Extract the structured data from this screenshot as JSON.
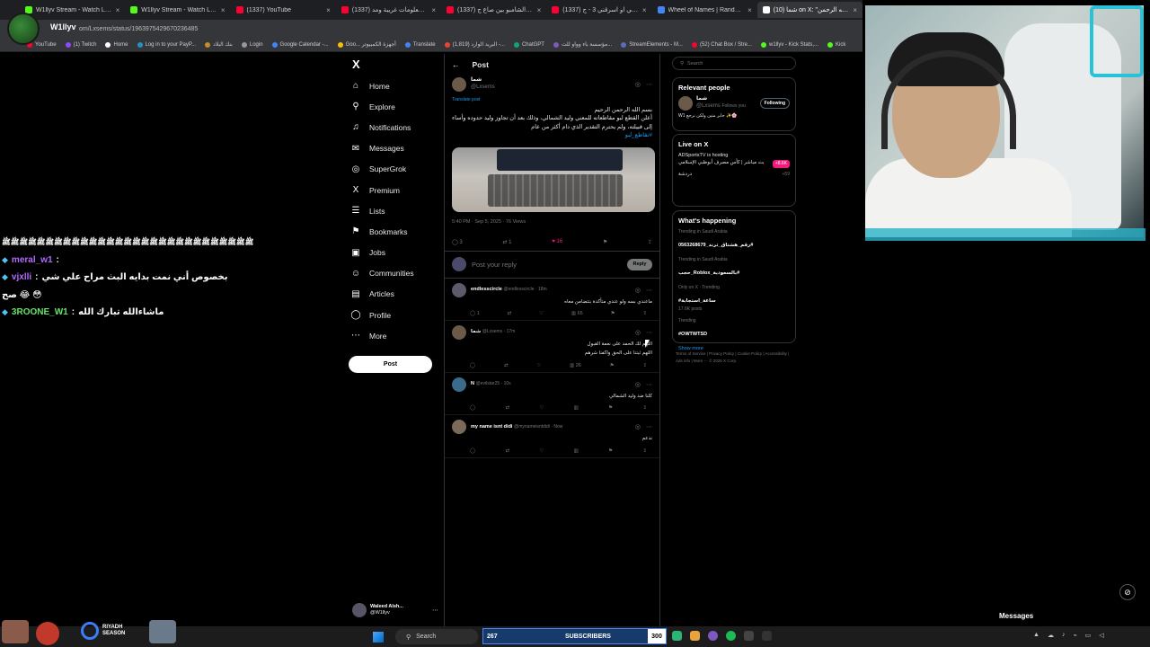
{
  "browser": {
    "tabs": [
      {
        "label": "W1llyv Stream - Watch Live on",
        "color": "#53fc18",
        "active": false
      },
      {
        "label": "W1llyv Stream - Watch Live on",
        "color": "#53fc18",
        "active": false
      },
      {
        "label": "(1337) YouTube",
        "color": "#ff0033",
        "active": false
      },
      {
        "label": "(1337) اربع معلومات غريبة ومد...",
        "color": "#ff0033",
        "active": false
      },
      {
        "label": "(1337) تحدي الشامبو بين صاع ج...",
        "color": "#ff0033",
        "active": false
      },
      {
        "label": "(1337) شاركني او اسرقني 3 - ج...",
        "color": "#ff0033",
        "active": false
      },
      {
        "label": "Wheel of Names | Random nam",
        "color": "#4285f4",
        "active": false
      },
      {
        "label": "(10) شما on X: \"بسم الله الرحمن",
        "color": "#ffffff",
        "active": true
      }
    ],
    "url": "om/Lxsems/status/1963975429670236485",
    "bookmarks": [
      {
        "label": "YouTube",
        "color": "#ff0033"
      },
      {
        "label": "(1) Twitch",
        "color": "#9146ff"
      },
      {
        "label": "Home",
        "color": "#ffffff"
      },
      {
        "label": "Log in to your PayP...",
        "color": "#2790c3"
      },
      {
        "label": "بنك البلاد",
        "color": "#c78b2a"
      },
      {
        "label": "Login",
        "color": "#999999"
      },
      {
        "label": "Google Calendar -...",
        "color": "#4285f4"
      },
      {
        "label": "Goo... أجهزة الكمبيوتر",
        "color": "#fbbc05"
      },
      {
        "label": "Translate",
        "color": "#4285f4"
      },
      {
        "label": "(1,819) البريد الوارد -...",
        "color": "#ea4335"
      },
      {
        "label": "ChatGPT",
        "color": "#10a37f"
      },
      {
        "label": "مؤسسة باء وواو للت...",
        "color": "#7e57c2"
      },
      {
        "label": "StreamElements - M...",
        "color": "#5c6bc0"
      },
      {
        "label": "(52) Chat Box / Stre...",
        "color": "#ff0033"
      },
      {
        "label": "w1llyv - Kick Stats,...",
        "color": "#53fc18"
      },
      {
        "label": "Kick",
        "color": "#53fc18"
      }
    ]
  },
  "streamer": {
    "name": "W1llyv"
  },
  "nav": {
    "logo": "X",
    "items": [
      {
        "label": "Home",
        "icon": "home-icon",
        "glyph": "⌂"
      },
      {
        "label": "Explore",
        "icon": "search-icon",
        "glyph": "⚲"
      },
      {
        "label": "Notifications",
        "icon": "bell-icon",
        "glyph": "♫"
      },
      {
        "label": "Messages",
        "icon": "mail-icon",
        "glyph": "✉"
      },
      {
        "label": "SuperGrok",
        "icon": "grok-icon",
        "glyph": "◎"
      },
      {
        "label": "Premium",
        "icon": "x-premium-icon",
        "glyph": "X"
      },
      {
        "label": "Lists",
        "icon": "list-icon",
        "glyph": "☰"
      },
      {
        "label": "Bookmarks",
        "icon": "bookmark-icon",
        "glyph": "⚑"
      },
      {
        "label": "Jobs",
        "icon": "briefcase-icon",
        "glyph": "▣"
      },
      {
        "label": "Communities",
        "icon": "people-icon",
        "glyph": "☺"
      },
      {
        "label": "Articles",
        "icon": "article-icon",
        "glyph": "▤"
      },
      {
        "label": "Profile",
        "icon": "profile-icon",
        "glyph": "◯"
      },
      {
        "label": "More",
        "icon": "more-icon",
        "glyph": "⋯"
      }
    ],
    "post_button": "Post",
    "account": {
      "name": "Waleed Alsh...",
      "handle": "@W1llyv"
    }
  },
  "post": {
    "header": "Post",
    "author": {
      "name": "شما",
      "handle": "@Lxsems"
    },
    "translate": "Translate post",
    "text_line1": "بسم الله الرحمن الرحيم",
    "text_line2": "أعلن القطع لبو مقاطعاته للمعني وليد الشمالي، وذلك بعد أن تجاوز وليد حدوده وأساء",
    "text_line3": "إلى قبيلته، ولم يحترم التقدير الذي دام أكثر من عام",
    "hashtag": "#نقاطع_لبو",
    "meta": "5:40 PM · Sep 5, 2025 · 76 Views",
    "actions": {
      "replies": "3",
      "reposts": "1",
      "likes": "16"
    },
    "reply_placeholder": "Post your reply",
    "reply_button": "Reply"
  },
  "replies": [
    {
      "name": "endlesscircle",
      "handle": "@endlesscircle · 18m",
      "text": "ماعندي بسه ولو عندي متأكدة بتتضامن معاه",
      "stats": {
        "r": "1",
        "rt": "",
        "l": "",
        "v": "65"
      }
    },
    {
      "name": "شما",
      "handle": "@Lxsems · 17m",
      "text": "اللهم لك الحمد على نعمة القبول",
      "text2": "اللهم ثبتنا على الحق واكفنا شرهم",
      "stats": {
        "r": "",
        "rt": "",
        "l": "",
        "v": "26"
      }
    },
    {
      "name": "N",
      "handle": "@evilstar25 · 10s",
      "text": "كلنا ضد وليد الشمالي",
      "stats": {
        "r": "",
        "rt": "",
        "l": "",
        "v": ""
      }
    },
    {
      "name": "my name isnt didi",
      "handle": "@mynameisntdidi · Now",
      "text": "ندعم",
      "stats": {
        "r": "",
        "rt": "",
        "l": "",
        "v": ""
      }
    }
  ],
  "sidebar": {
    "search_placeholder": "Search",
    "relevant": {
      "title": "Relevant people",
      "name": "شما",
      "handle": "@Lxsems",
      "follows_you": "Follows you",
      "button": "Following",
      "bio": "W1 حابر متين ولكن نرجع ✨🌸"
    },
    "live": {
      "title": "Live on X",
      "host": "ADSportsTV is hosting",
      "desc": "بث مباشر | كأس مصرف أبوظبي الإسلامي",
      "badge": "+8.6K",
      "category": "دردشة",
      "count": "+59"
    },
    "happening": {
      "title": "What's happening",
      "trends": [
        {
          "meta": "Trending in Saudi Arabia",
          "tag": "0563268679_رقم_هشتاق_ترند#"
        },
        {
          "meta": "Trending in Saudi Arabia",
          "tag": "حجب_Roblox_بالسعودية#"
        },
        {
          "meta": "Only on X · Trending",
          "tag": "#ساعة_استجابة",
          "posts": "17.6K posts"
        },
        {
          "meta": "Trending",
          "tag": "#OWTWTSD"
        }
      ],
      "show_more": "Show more"
    },
    "footer": "Terms of Service | Privacy Policy | Cookie Policy | Accessibility | Ads info | More ··· © 2025 X Corp."
  },
  "chat": {
    "spam": "ﷺﷺﷺﷺﷺﷺﷺﷺﷺﷺﷺﷺﷺﷺﷺﷺﷺﷺﷺﷺﷺﷺﷺﷺﷺﷺﷺﷺﷺ",
    "lines": [
      {
        "user": "meral_w1",
        "sep": ":",
        "msg": "",
        "color": "purple"
      },
      {
        "user": "vjxlli",
        "sep": ":",
        "msg": "بخصوص أني نمت بدايه البث مراح علي شي",
        "color": "purple"
      },
      {
        "user": "",
        "sep": "",
        "msg": "صح 😂 😳",
        "color": "purple"
      },
      {
        "user": "3ROONE_W1",
        "sep": ":",
        "msg": "ماشاءالله تبارك الله",
        "color": "green"
      }
    ]
  },
  "taskbar": {
    "search": "Search",
    "subs_count": "267",
    "subs_label": "SUBSCRIBERS",
    "subs_goal": "300",
    "riyadh_line1": "RIYADH",
    "riyadh_line2": "SEASON",
    "messages": "Messages"
  }
}
